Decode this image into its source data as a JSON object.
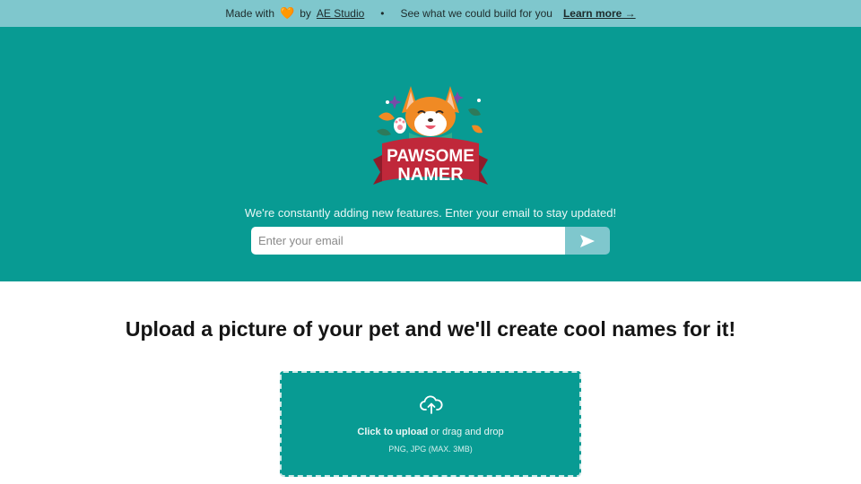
{
  "banner": {
    "made_with": "Made with",
    "heart": "🧡",
    "by": "by",
    "studio_link": "AE Studio",
    "bullet": "•",
    "tagline": "See what we could build for you",
    "learn_more": "Learn more →"
  },
  "logo": {
    "line1": "PAWSOME",
    "line2": "NAMER"
  },
  "subscribe": {
    "text": "We're constantly adding new features. Enter your email to stay updated!",
    "placeholder": "Enter your email"
  },
  "main": {
    "title": "Upload a picture of your pet and we'll create cool names for it!"
  },
  "upload": {
    "click_label": "Click to upload",
    "rest_label": " or drag and drop",
    "hint": "PNG, JPG (MAX. 3MB)"
  },
  "colors": {
    "teal": "#089b93",
    "light_teal": "#7fc7cd",
    "banner_red": "#c0283a",
    "corgi_orange": "#f08a24"
  },
  "icons": {
    "send": "send-icon",
    "upload": "cloud-upload-icon"
  }
}
